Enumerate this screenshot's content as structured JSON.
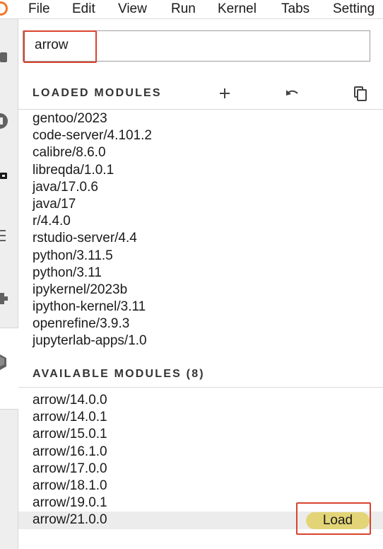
{
  "menubar": {
    "items": [
      "File",
      "Edit",
      "View",
      "Run",
      "Kernel",
      "Tabs",
      "Setting"
    ]
  },
  "search": {
    "value": "arrow"
  },
  "loaded": {
    "title": "LOADED MODULES",
    "modules": [
      "gentoo/2023",
      "code-server/4.101.2",
      "calibre/8.6.0",
      "libreqda/1.0.1",
      "java/17.0.6",
      "java/17",
      "r/4.4.0",
      "rstudio-server/4.4",
      "python/3.11.5",
      "python/3.11",
      "ipykernel/2023b",
      "ipython-kernel/3.11",
      "openrefine/3.9.3",
      "jupyterlab-apps/1.0"
    ],
    "icons": [
      "plus-icon",
      "undo-icon",
      "copy-icon"
    ]
  },
  "available": {
    "title": "AVAILABLE MODULES (8)",
    "modules": [
      "arrow/14.0.0",
      "arrow/14.0.1",
      "arrow/15.0.1",
      "arrow/16.1.0",
      "arrow/17.0.0",
      "arrow/18.1.0",
      "arrow/19.0.1",
      "arrow/21.0.0"
    ],
    "selected_index": 7,
    "load_label": "Load"
  },
  "colors": {
    "accent_logo": "#f37726",
    "highlight_box": "#d9432f",
    "load_button": "#e3d577"
  }
}
